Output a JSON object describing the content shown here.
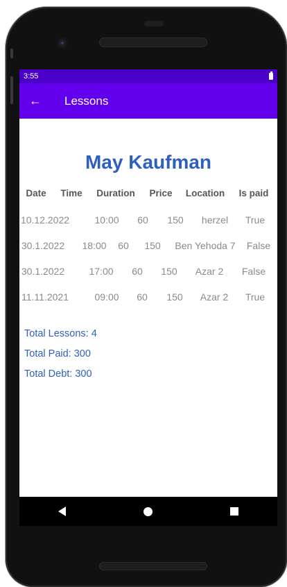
{
  "status_bar": {
    "time": "3:55"
  },
  "app_bar": {
    "title": "Lessons",
    "back_icon": "arrow-left-icon",
    "back_glyph": "←"
  },
  "profile": {
    "name": "May Kaufman"
  },
  "lessons_table": {
    "headers": [
      "Date",
      "Time",
      "Duration",
      "Price",
      "Location",
      "Is paid"
    ],
    "rows": [
      [
        "10.12.2022",
        "10:00",
        "60",
        "150",
        "herzel",
        "True"
      ],
      [
        "30.1.2022",
        "18:00",
        "60",
        "150",
        "Ben Yehoda 7",
        "False"
      ],
      [
        "30.1.2022",
        "17:00",
        "60",
        "150",
        "Azar 2",
        "False"
      ],
      [
        "11.11.2021",
        "09:00",
        "60",
        "150",
        "Azar 2",
        "True"
      ]
    ]
  },
  "totals": {
    "lessons": "Total Lessons: 4",
    "paid": "Total Paid: 300",
    "debt": "Total Debt: 300"
  },
  "nav_bar": {
    "back_icon": "triangle-back-icon",
    "home_icon": "circle-home-icon",
    "recents_icon": "square-recents-icon"
  },
  "colors": {
    "status_bar": "#4a00c8",
    "app_bar": "#6200ee",
    "accent_text": "#2f5fbe"
  }
}
